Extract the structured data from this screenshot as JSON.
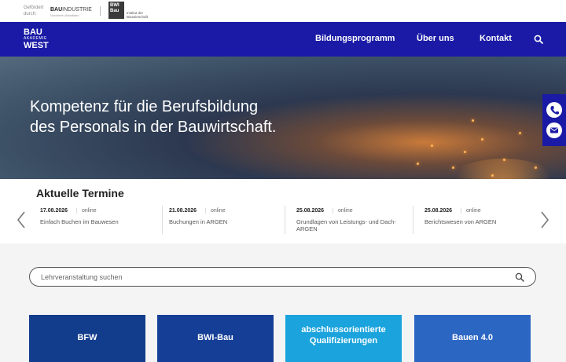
{
  "topbar": {
    "sponsor_label": "Gefördert durch:",
    "logo1_bold": "BAU",
    "logo1_rest": "INDUSTRIE",
    "logo1_sub": "Nordrhein-Westfalen",
    "bwi_mark": "BWI Bau",
    "bwi_text": "Institut der Bauwirtschaft"
  },
  "nav": {
    "brand_top": "BAU",
    "brand_mid": "AKADEMIE",
    "brand_bottom": "WEST",
    "items": [
      {
        "label": "Bildungsprogramm"
      },
      {
        "label": "Über uns"
      },
      {
        "label": "Kontakt"
      }
    ],
    "search_icon": "search-icon"
  },
  "hero": {
    "headline_line1": "Kompetenz für die Berufsbildung",
    "headline_line2": "des Personals in der Bauwirtschaft."
  },
  "side_contact": {
    "icons": [
      "phone-icon",
      "mail-icon"
    ]
  },
  "termine": {
    "heading": "Aktuelle Termine",
    "items": [
      {
        "date": "17.08.2026",
        "mode": "online",
        "title": "Einfach Buchen im Bauwesen"
      },
      {
        "date": "21.08.2026",
        "mode": "online",
        "title": "Buchungen in ARGEN"
      },
      {
        "date": "25.08.2026",
        "mode": "online",
        "title": "Grundlagen von Leistungs- und Dach-ARGEN"
      },
      {
        "date": "25.08.2026",
        "mode": "online",
        "title": "Berichtswesen von ARGEN"
      }
    ]
  },
  "search": {
    "placeholder": "Lehrveranstaltung suchen"
  },
  "tiles": [
    {
      "label": "BFW",
      "color": "#123c8c"
    },
    {
      "label": "BWI-Bau",
      "color": "#153f97"
    },
    {
      "label": "abschlussorientierte Qualifizierungen",
      "color": "#1aa3dc"
    },
    {
      "label": "Bauen 4.0",
      "color": "#2b66c3"
    }
  ],
  "colors": {
    "nav_bg": "#1a1aa6",
    "accent_white": "#ffffff"
  }
}
